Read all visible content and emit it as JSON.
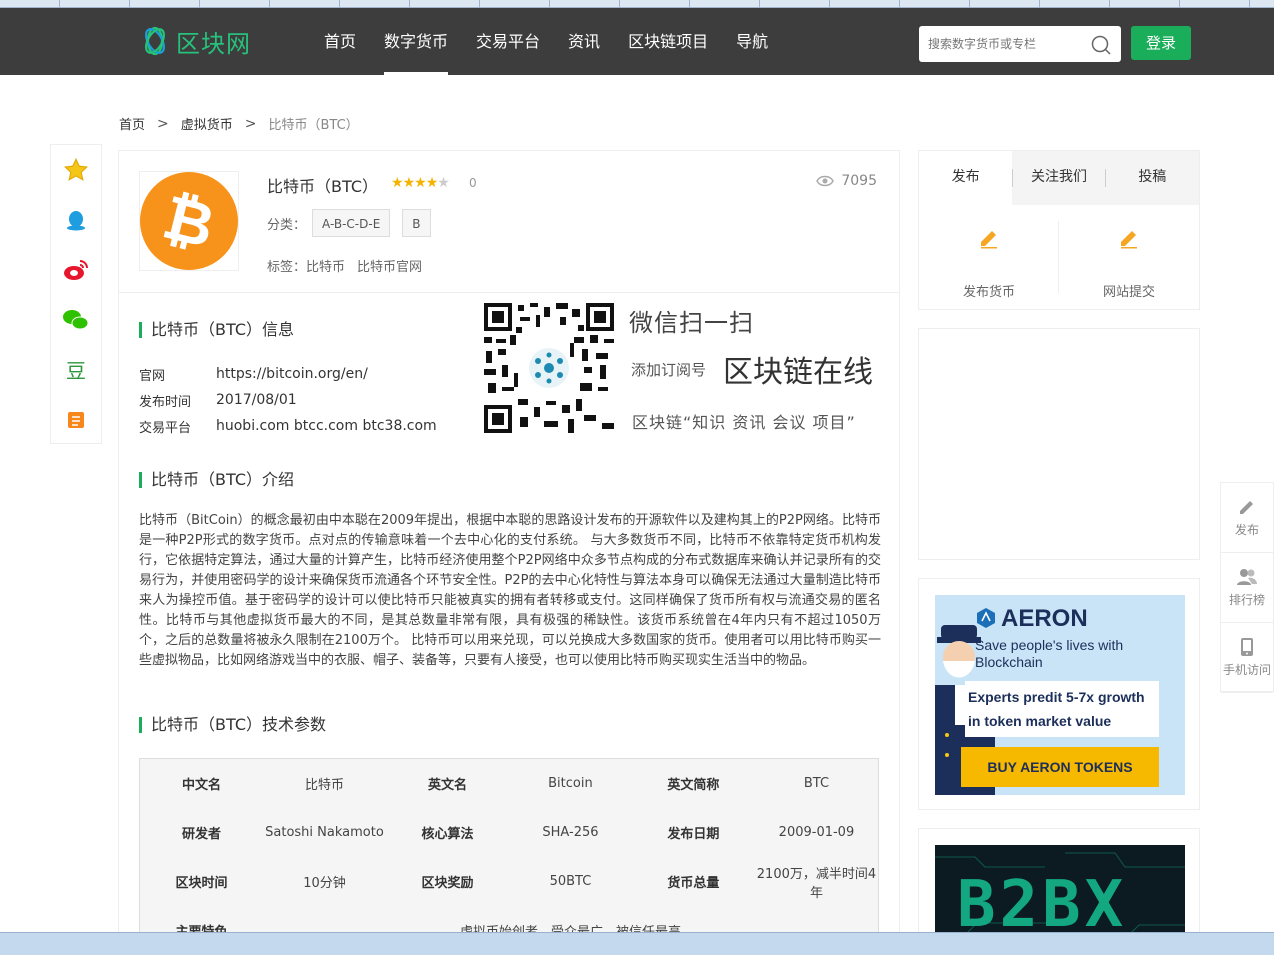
{
  "site": {
    "logo_text": "区块网"
  },
  "nav": {
    "items": [
      "首页",
      "数字货币",
      "交易平台",
      "资讯",
      "区块链项目",
      "导航"
    ],
    "active_index": 1
  },
  "search": {
    "placeholder": "搜索数字货币或专栏"
  },
  "login_label": "登录",
  "breadcrumb": {
    "items": [
      "首页",
      "虚拟货币",
      "比特币（BTC）"
    ],
    "separator": ">"
  },
  "coin": {
    "name": "比特币（BTC）",
    "rating_stars": 4,
    "rating_max": 5,
    "rating_count": "0",
    "views": "7095",
    "category_label": "分类：",
    "categories": [
      "A-B-C-D-E",
      "B"
    ],
    "tags_label": "标签：",
    "tags": [
      "比特币",
      "比特币官网"
    ],
    "logo_glyph": "₿"
  },
  "info_section": {
    "title": "比特币（BTC）信息",
    "rows": [
      {
        "key": "官网",
        "value": "https://bitcoin.org/en/"
      },
      {
        "key": "发布时间",
        "value": "2017/08/01"
      },
      {
        "key": "交易平台",
        "value": "huobi.com btcc.com btc38.com"
      }
    ]
  },
  "wechat": {
    "scan": "微信扫一扫",
    "subscribe_label": "添加订阅号",
    "account": "区块链在线",
    "slogan": "区块链“知识 资讯 会议 项目”"
  },
  "intro_section": {
    "title": "比特币（BTC）介绍",
    "text": "比特币（BitCoin）的概念最初由中本聪在2009年提出，根据中本聪的思路设计发布的开源软件以及建构其上的P2P网络。比特币是一种P2P形式的数字货币。点对点的传输意味着一个去中心化的支付系统。 与大多数货币不同，比特币不依靠特定货币机构发行，它依据特定算法，通过大量的计算产生，比特币经济使用整个P2P网络中众多节点构成的分布式数据库来确认并记录所有的交易行为，并使用密码学的设计来确保货币流通各个环节安全性。P2P的去中心化特性与算法本身可以确保无法通过大量制造比特币来人为操控币值。基于密码学的设计可以使比特币只能被真实的拥有者转移或支付。这同样确保了货币所有权与流通交易的匿名性。比特币与其他虚拟货币最大的不同，是其总数量非常有限，具有极强的稀缺性。该货币系统曾在4年内只有不超过1050万个，之后的总数量将被永久限制在2100万个。 比特币可以用来兑现，可以兑换成大多数国家的货币。使用者可以用比特币购买一些虚拟物品，比如网络游戏当中的衣服、帽子、装备等，只要有人接受，也可以使用比特币购买现实生活当中的物品。"
  },
  "tech_section": {
    "title": "比特币（BTC）技术参数",
    "rows": [
      [
        "中文名",
        "比特币",
        "英文名",
        "Bitcoin",
        "英文简称",
        "BTC"
      ],
      [
        "研发者",
        "Satoshi Nakamoto",
        "核心算法",
        "SHA-256",
        "发布日期",
        "2009-01-09"
      ],
      [
        "区块时间",
        "10分钟",
        "区块奖励",
        "50BTC",
        "货币总量",
        "2100万，减半时间4年"
      ]
    ],
    "partial_row": {
      "key": "主要特色",
      "value": "虚拟币始创者，受众最广，被信任最高"
    }
  },
  "sidebar": {
    "tabs": [
      "发布",
      "关注我们",
      "投稿"
    ],
    "active_tab": 0,
    "buttons": [
      "发布货币",
      "网站提交"
    ]
  },
  "ad_aeron": {
    "brand": "AERON",
    "tagline": "Save people's lives with Blockchain",
    "bubble": "Experts predit 5-7x growth in token market value",
    "cta": "BUY AERON TOKENS"
  },
  "ad_b2bx": {
    "brand": "B2BX"
  },
  "float_bar": {
    "items": [
      "发布",
      "排行榜",
      "手机访问"
    ]
  },
  "left_share": {
    "icons": [
      "star-icon",
      "qq-icon",
      "weibo-icon",
      "wechat-icon",
      "douban-icon",
      "book-icon"
    ]
  },
  "colors": {
    "accent_green": "#1aad5a",
    "topbar": "#3d3d3d",
    "coin_orange": "#f7931a",
    "star": "#f5b300"
  }
}
